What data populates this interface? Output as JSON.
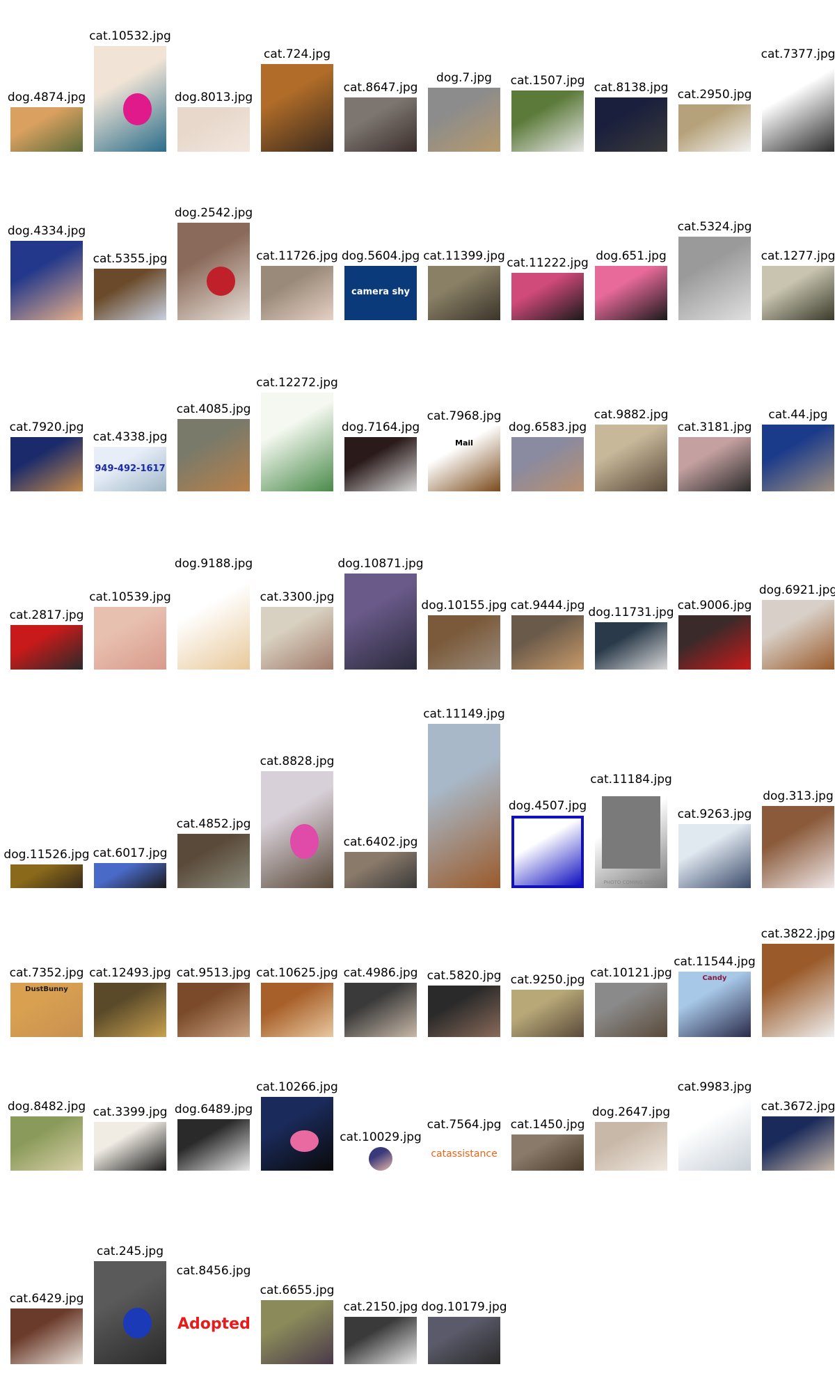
{
  "rows": [
    [
      {
        "file": "dog.4874.jpg",
        "w": 104,
        "h": 64,
        "c": [
          "#d9a060",
          "#5a6b3a"
        ]
      },
      {
        "file": "cat.10532.jpg",
        "w": 104,
        "h": 152,
        "c": [
          "#f1e4d6",
          "#2a6d8a"
        ],
        "accent": "#e01a8a"
      },
      {
        "file": "dog.8013.jpg",
        "w": 104,
        "h": 64,
        "c": [
          "#e8d8cc",
          "#f2e6dc"
        ]
      },
      {
        "file": "cat.724.jpg",
        "w": 104,
        "h": 126,
        "c": [
          "#b06c28",
          "#3a2a1e"
        ]
      },
      {
        "file": "cat.8647.jpg",
        "w": 104,
        "h": 78,
        "c": [
          "#7d7670",
          "#3b2e2c"
        ]
      },
      {
        "file": "dog.7.jpg",
        "w": 104,
        "h": 92,
        "c": [
          "#8c8c8c",
          "#b79a6c"
        ]
      },
      {
        "file": "cat.1507.jpg",
        "w": 104,
        "h": 88,
        "c": [
          "#5c7a3a",
          "#e8e8e8"
        ]
      },
      {
        "file": "cat.8138.jpg",
        "w": 104,
        "h": 78,
        "c": [
          "#1a1f3d",
          "#3a3a3a"
        ]
      },
      {
        "file": "cat.2950.jpg",
        "w": 104,
        "h": 68,
        "c": [
          "#b6a27a",
          "#f2f2f2"
        ]
      },
      {
        "file": "cat.7377.jpg",
        "w": 104,
        "h": 126,
        "c": [
          "#ffffff",
          "#2a2a2a"
        ]
      }
    ],
    [
      {
        "file": "dog.4334.jpg",
        "w": 104,
        "h": 114,
        "c": [
          "#23388a",
          "#e8b08a"
        ]
      },
      {
        "file": "cat.5355.jpg",
        "w": 104,
        "h": 74,
        "c": [
          "#6a4a2a",
          "#c8d0e0"
        ]
      },
      {
        "file": "dog.2542.jpg",
        "w": 104,
        "h": 140,
        "c": [
          "#8a6a5a",
          "#e8e0d8"
        ],
        "accent": "#c0202a"
      },
      {
        "file": "cat.11726.jpg",
        "w": 104,
        "h": 78,
        "c": [
          "#9a8a7a",
          "#e6d0c4"
        ]
      },
      {
        "file": "dog.5604.jpg",
        "w": 104,
        "h": 78,
        "c": [
          "#0a3a7a",
          "#0a3a7a"
        ],
        "text": "camera shy",
        "textColor": "#ffffff"
      },
      {
        "file": "cat.11399.jpg",
        "w": 104,
        "h": 78,
        "c": [
          "#8a8066",
          "#3a342a"
        ]
      },
      {
        "file": "cat.11222.jpg",
        "w": 104,
        "h": 68,
        "c": [
          "#d04a7a",
          "#1a1a1a"
        ]
      },
      {
        "file": "dog.651.jpg",
        "w": 104,
        "h": 78,
        "c": [
          "#e86a9a",
          "#1a1a1a"
        ]
      },
      {
        "file": "cat.5324.jpg",
        "w": 104,
        "h": 120,
        "c": [
          "#9a9a9a",
          "#e0e0e0"
        ]
      },
      {
        "file": "cat.1277.jpg",
        "w": 104,
        "h": 78,
        "c": [
          "#c8c4b0",
          "#3a3a2a"
        ]
      }
    ],
    [
      {
        "file": "cat.7920.jpg",
        "w": 104,
        "h": 78,
        "c": [
          "#1a2a6a",
          "#c48a4a"
        ]
      },
      {
        "file": "cat.4338.jpg",
        "w": 104,
        "h": 64,
        "c": [
          "#e8eef8",
          "#a0b8c8"
        ],
        "text": "949-492-1617",
        "textColor": "#1a2aa8"
      },
      {
        "file": "cat.4085.jpg",
        "w": 104,
        "h": 104,
        "c": [
          "#7a7a6a",
          "#b8804a"
        ]
      },
      {
        "file": "cat.12272.jpg",
        "w": 104,
        "h": 142,
        "c": [
          "#f4f8f0",
          "#4a8a4a"
        ]
      },
      {
        "file": "dog.7164.jpg",
        "w": 104,
        "h": 78,
        "c": [
          "#2a1a1a",
          "#d8d8d8"
        ]
      },
      {
        "file": "cat.7968.jpg",
        "w": 104,
        "h": 94,
        "c": [
          "#ffffff",
          "#7a4a1a"
        ],
        "text": "Mail",
        "textColor": "#000000"
      },
      {
        "file": "dog.6583.jpg",
        "w": 104,
        "h": 78,
        "c": [
          "#8a8aa0",
          "#b89070"
        ]
      },
      {
        "file": "cat.9882.jpg",
        "w": 104,
        "h": 96,
        "c": [
          "#c8b89a",
          "#5a4a3a"
        ]
      },
      {
        "file": "cat.3181.jpg",
        "w": 104,
        "h": 78,
        "c": [
          "#c4a0a0",
          "#2a2a2a"
        ]
      },
      {
        "file": "cat.44.jpg",
        "w": 104,
        "h": 96,
        "c": [
          "#1a3a8a",
          "#a09080"
        ]
      }
    ],
    [
      {
        "file": "cat.2817.jpg",
        "w": 104,
        "h": 64,
        "c": [
          "#c81a1a",
          "#2a2a2a"
        ]
      },
      {
        "file": "cat.10539.jpg",
        "w": 104,
        "h": 90,
        "c": [
          "#e8c0b0",
          "#d89a8a"
        ]
      },
      {
        "file": "dog.9188.jpg",
        "w": 104,
        "h": 138,
        "c": [
          "#ffffff",
          "#e8c89a"
        ]
      },
      {
        "file": "cat.3300.jpg",
        "w": 104,
        "h": 90,
        "c": [
          "#d8d0c0",
          "#a07a6a"
        ]
      },
      {
        "file": "dog.10871.jpg",
        "w": 104,
        "h": 138,
        "c": [
          "#6a5a8a",
          "#2a2a3a"
        ]
      },
      {
        "file": "dog.10155.jpg",
        "w": 104,
        "h": 78,
        "c": [
          "#7a5a3a",
          "#9a8a7a"
        ]
      },
      {
        "file": "cat.9444.jpg",
        "w": 104,
        "h": 78,
        "c": [
          "#6a5a4a",
          "#c89a6a"
        ]
      },
      {
        "file": "dog.11731.jpg",
        "w": 104,
        "h": 68,
        "c": [
          "#2a3a4a",
          "#d8d8d8"
        ]
      },
      {
        "file": "cat.9006.jpg",
        "w": 104,
        "h": 78,
        "c": [
          "#3a2a2a",
          "#c81a1a"
        ]
      },
      {
        "file": "dog.6921.jpg",
        "w": 104,
        "h": 100,
        "c": [
          "#d8d0c8",
          "#9a5a2a"
        ]
      }
    ],
    [
      {
        "file": "dog.11526.jpg",
        "w": 104,
        "h": 34,
        "c": [
          "#8a6a1a",
          "#3a2a1a"
        ]
      },
      {
        "file": "cat.6017.jpg",
        "w": 104,
        "h": 36,
        "c": [
          "#4a6ac8",
          "#1a1a1a"
        ]
      },
      {
        "file": "cat.4852.jpg",
        "w": 104,
        "h": 78,
        "c": [
          "#5a4a3a",
          "#8a8a7a"
        ]
      },
      {
        "file": "cat.8828.jpg",
        "w": 104,
        "h": 168,
        "c": [
          "#d8d0d8",
          "#5a4a3a"
        ],
        "accent": "#e04aa8"
      },
      {
        "file": "cat.6402.jpg",
        "w": 104,
        "h": 52,
        "c": [
          "#8a7a6a",
          "#3a3a3a"
        ]
      },
      {
        "file": "cat.11149.jpg",
        "w": 104,
        "h": 236,
        "c": [
          "#a8b8c8",
          "#9a5a2a"
        ]
      },
      {
        "file": "dog.4507.jpg",
        "w": 104,
        "h": 104,
        "c": [
          "#ffffff",
          "#1010c0"
        ]
      },
      {
        "file": "cat.11184.jpg",
        "w": 104,
        "h": 142,
        "c": [
          "#ffffff",
          "#7a7a7a"
        ],
        "text": "PHOTO COMING SOON",
        "textColor": "#888888"
      },
      {
        "file": "cat.9263.jpg",
        "w": 104,
        "h": 92,
        "c": [
          "#e0e8f0",
          "#3a4a6a"
        ]
      },
      {
        "file": "dog.313.jpg",
        "w": 104,
        "h": 118,
        "c": [
          "#8a5a3a",
          "#f0e8e8"
        ]
      }
    ],
    [
      {
        "file": "cat.7352.jpg",
        "w": 104,
        "h": 78,
        "c": [
          "#d8a050",
          "#c89050"
        ],
        "text": "DustBunny",
        "textColor": "#1a1a1a"
      },
      {
        "file": "cat.12493.jpg",
        "w": 104,
        "h": 78,
        "c": [
          "#5a4a2a",
          "#c8a050"
        ]
      },
      {
        "file": "cat.9513.jpg",
        "w": 104,
        "h": 78,
        "c": [
          "#7a4a2a",
          "#c8a080"
        ]
      },
      {
        "file": "cat.10625.jpg",
        "w": 104,
        "h": 78,
        "c": [
          "#a8602a",
          "#e8c8a0"
        ]
      },
      {
        "file": "cat.4986.jpg",
        "w": 104,
        "h": 78,
        "c": [
          "#3a3a3a",
          "#c8b8a8"
        ]
      },
      {
        "file": "cat.5820.jpg",
        "w": 104,
        "h": 74,
        "c": [
          "#2a2a2a",
          "#8a6a5a"
        ]
      },
      {
        "file": "cat.9250.jpg",
        "w": 104,
        "h": 68,
        "c": [
          "#b8a878",
          "#5a4a3a"
        ]
      },
      {
        "file": "cat.10121.jpg",
        "w": 104,
        "h": 78,
        "c": [
          "#8a8a8a",
          "#5a4a3a"
        ]
      },
      {
        "file": "cat.11544.jpg",
        "w": 104,
        "h": 94,
        "c": [
          "#a8c8e8",
          "#2a2a4a"
        ],
        "text": "Candy",
        "textColor": "#8a1a3a"
      },
      {
        "file": "cat.3822.jpg",
        "w": 104,
        "h": 134,
        "c": [
          "#9a5a2a",
          "#f0f0f0"
        ]
      }
    ],
    [
      {
        "file": "dog.8482.jpg",
        "w": 104,
        "h": 78,
        "c": [
          "#8a9a5a",
          "#d8d0a8"
        ]
      },
      {
        "file": "cat.3399.jpg",
        "w": 104,
        "h": 70,
        "c": [
          "#f0ece4",
          "#1a1a1a"
        ]
      },
      {
        "file": "dog.6489.jpg",
        "w": 104,
        "h": 74,
        "c": [
          "#2a2a2a",
          "#e8e8e8"
        ]
      },
      {
        "file": "cat.10266.jpg",
        "w": 104,
        "h": 106,
        "c": [
          "#1a2a5a",
          "#0a0a0a"
        ],
        "accent": "#e86aa0"
      },
      {
        "file": "cat.10029.jpg",
        "w": 34,
        "h": 34,
        "c": [
          "#3a3a7a",
          "#e8b8a8"
        ],
        "round": true
      },
      {
        "file": "cat.7564.jpg",
        "w": 104,
        "h": 52,
        "c": [
          "#ffffff",
          "#ffffff"
        ],
        "text": "catassistance",
        "textColor": "#e8641a"
      },
      {
        "file": "cat.1450.jpg",
        "w": 104,
        "h": 52,
        "c": [
          "#8a7a6a",
          "#4a3a2a"
        ]
      },
      {
        "file": "dog.2647.jpg",
        "w": 104,
        "h": 70,
        "c": [
          "#c8b8a8",
          "#f0e8e0"
        ]
      },
      {
        "file": "cat.9983.jpg",
        "w": 104,
        "h": 106,
        "c": [
          "#ffffff",
          "#c8d0d8"
        ]
      },
      {
        "file": "cat.3672.jpg",
        "w": 104,
        "h": 78,
        "c": [
          "#1a2a5a",
          "#c8b8a8"
        ]
      }
    ],
    [
      {
        "file": "cat.6429.jpg",
        "w": 104,
        "h": 80,
        "c": [
          "#6a3a2a",
          "#e8e0d8"
        ]
      },
      {
        "file": "cat.245.jpg",
        "w": 104,
        "h": 148,
        "c": [
          "#5a5a5a",
          "#2a2a2a"
        ],
        "accent": "#1a3ab8"
      },
      {
        "file": "cat.8456.jpg",
        "w": 104,
        "h": 120,
        "c": [
          "#ffffff",
          "#ffffff"
        ],
        "text": "Adopted",
        "textColor": "#e81a1a"
      },
      {
        "file": "cat.6655.jpg",
        "w": 104,
        "h": 92,
        "c": [
          "#8a8a5a",
          "#4a3a4a"
        ]
      },
      {
        "file": "cat.2150.jpg",
        "w": 104,
        "h": 68,
        "c": [
          "#3a3a3a",
          "#e8e8e8"
        ]
      },
      {
        "file": "dog.10179.jpg",
        "w": 104,
        "h": 68,
        "c": [
          "#5a5a6a",
          "#2a2a2a"
        ]
      }
    ]
  ]
}
